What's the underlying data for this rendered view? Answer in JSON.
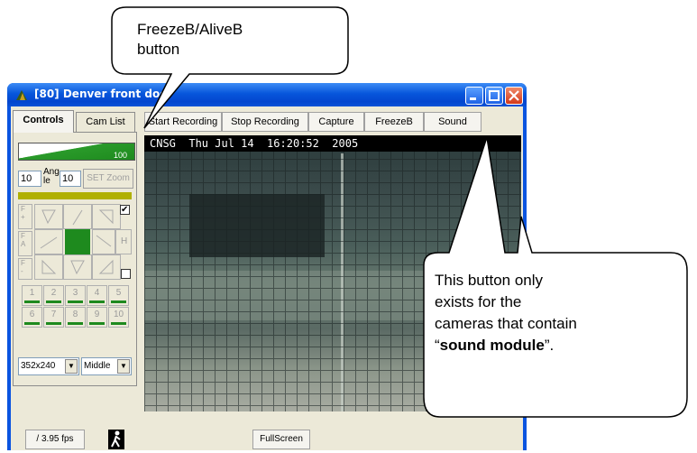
{
  "window": {
    "title": "[80] Denver front door"
  },
  "tabs": [
    {
      "label": "Controls"
    },
    {
      "label": "Cam List"
    }
  ],
  "toolbar": {
    "start_recording": "Start Recording",
    "stop_recording": "Stop Recording",
    "capture": "Capture",
    "freeze": "FreezeB",
    "sound": "Sound"
  },
  "zoom": {
    "min": "0",
    "max": "100",
    "value1": "10",
    "angle_label": "Angle",
    "value2": "10",
    "set_label": "SET Zoom"
  },
  "ptz": {
    "f_plus": "F +",
    "f_a": "F A",
    "f_minus": "F -",
    "h_label": "H"
  },
  "presets": [
    "1",
    "2",
    "3",
    "4",
    "5",
    "6",
    "7",
    "8",
    "9",
    "10"
  ],
  "resolution": {
    "selected": "352x240"
  },
  "quality": {
    "selected": "Middle"
  },
  "video": {
    "osd": "CNSG  Thu Jul 14  16:20:52  2005"
  },
  "status": {
    "fps": "/ 3.95 fps",
    "fullscreen": "FullScreen"
  },
  "callouts": {
    "top": {
      "line1": "FreezeB/AliveB",
      "line2": "button"
    },
    "right": {
      "l1": "This button only",
      "l2": "exists for the",
      "l3": "cameras that contain",
      "l4_open": "“",
      "l4_bold": "sound module",
      "l4_close": "”."
    }
  },
  "colors": {
    "titlebar": "#0756db",
    "accent_green": "#1e8a1e",
    "face": "#ece9d8"
  }
}
